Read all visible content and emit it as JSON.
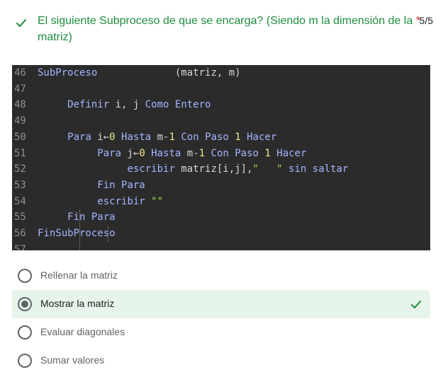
{
  "question": {
    "title": "El siguiente Subproceso de que se encarga? (Siendo m la dimensión de la matriz)",
    "title_line1": "El siguiente Subproceso de que se encarga? (Siendo m la dimensión de la",
    "title_line2": "matriz)",
    "required_mark": "*",
    "score": "5/5",
    "status_icon": "check-icon",
    "accent_color": "#1e8e3e",
    "required_color": "#d93025"
  },
  "code": {
    "background": "#2b2b2b",
    "lines": [
      {
        "num": "46",
        "segments": [
          {
            "t": "SubProceso",
            "c": "kw"
          },
          {
            "t": "             (matriz, m)",
            "c": "plain"
          }
        ]
      },
      {
        "num": "47",
        "segments": []
      },
      {
        "num": "48",
        "segments": [
          {
            "t": "     ",
            "c": "plain"
          },
          {
            "t": "Definir",
            "c": "kw"
          },
          {
            "t": " i, j ",
            "c": "plain"
          },
          {
            "t": "Como Entero",
            "c": "kw"
          }
        ]
      },
      {
        "num": "49",
        "segments": []
      },
      {
        "num": "50",
        "segments": [
          {
            "t": "     ",
            "c": "plain"
          },
          {
            "t": "Para",
            "c": "kw"
          },
          {
            "t": " i←",
            "c": "plain"
          },
          {
            "t": "0",
            "c": "num"
          },
          {
            "t": " ",
            "c": "plain"
          },
          {
            "t": "Hasta",
            "c": "kw"
          },
          {
            "t": " m-",
            "c": "plain"
          },
          {
            "t": "1",
            "c": "num"
          },
          {
            "t": " ",
            "c": "plain"
          },
          {
            "t": "Con Paso",
            "c": "kw"
          },
          {
            "t": " ",
            "c": "plain"
          },
          {
            "t": "1",
            "c": "num"
          },
          {
            "t": " ",
            "c": "plain"
          },
          {
            "t": "Hacer",
            "c": "kw"
          }
        ]
      },
      {
        "num": "51",
        "segments": [
          {
            "t": "          ",
            "c": "plain"
          },
          {
            "t": "Para",
            "c": "kw"
          },
          {
            "t": " j←",
            "c": "plain"
          },
          {
            "t": "0",
            "c": "num"
          },
          {
            "t": " ",
            "c": "plain"
          },
          {
            "t": "Hasta",
            "c": "kw"
          },
          {
            "t": " m-",
            "c": "plain"
          },
          {
            "t": "1",
            "c": "num"
          },
          {
            "t": " ",
            "c": "plain"
          },
          {
            "t": "Con Paso",
            "c": "kw"
          },
          {
            "t": " ",
            "c": "plain"
          },
          {
            "t": "1",
            "c": "num"
          },
          {
            "t": " ",
            "c": "plain"
          },
          {
            "t": "Hacer",
            "c": "kw"
          }
        ]
      },
      {
        "num": "52",
        "segments": [
          {
            "t": "               ",
            "c": "plain"
          },
          {
            "t": "escribir",
            "c": "kw"
          },
          {
            "t": " matriz[i,j],",
            "c": "plain"
          },
          {
            "t": "\"   \"",
            "c": "str"
          },
          {
            "t": " ",
            "c": "plain"
          },
          {
            "t": "sin saltar",
            "c": "kw"
          }
        ]
      },
      {
        "num": "53",
        "segments": [
          {
            "t": "          ",
            "c": "plain"
          },
          {
            "t": "Fin Para",
            "c": "kw"
          }
        ]
      },
      {
        "num": "54",
        "segments": [
          {
            "t": "          ",
            "c": "plain"
          },
          {
            "t": "escribir",
            "c": "kw"
          },
          {
            "t": " ",
            "c": "plain"
          },
          {
            "t": "\"\"",
            "c": "str"
          }
        ]
      },
      {
        "num": "55",
        "segments": [
          {
            "t": "     ",
            "c": "plain"
          },
          {
            "t": "Fin Para",
            "c": "kw"
          }
        ]
      },
      {
        "num": "56",
        "segments": [
          {
            "t": "FinSubProceso",
            "c": "kw"
          }
        ]
      },
      {
        "num": "57",
        "segments": []
      }
    ]
  },
  "options": [
    {
      "label": "Rellenar la matriz",
      "selected": false,
      "correct": false
    },
    {
      "label": "Mostrar la matriz",
      "selected": true,
      "correct": true
    },
    {
      "label": "Evaluar diagonales",
      "selected": false,
      "correct": false
    },
    {
      "label": "Sumar valores",
      "selected": false,
      "correct": false
    }
  ],
  "colors": {
    "selected_bg": "#e6f4ea",
    "correct_check": "#1e8e3e",
    "radio": "#5f6368"
  }
}
